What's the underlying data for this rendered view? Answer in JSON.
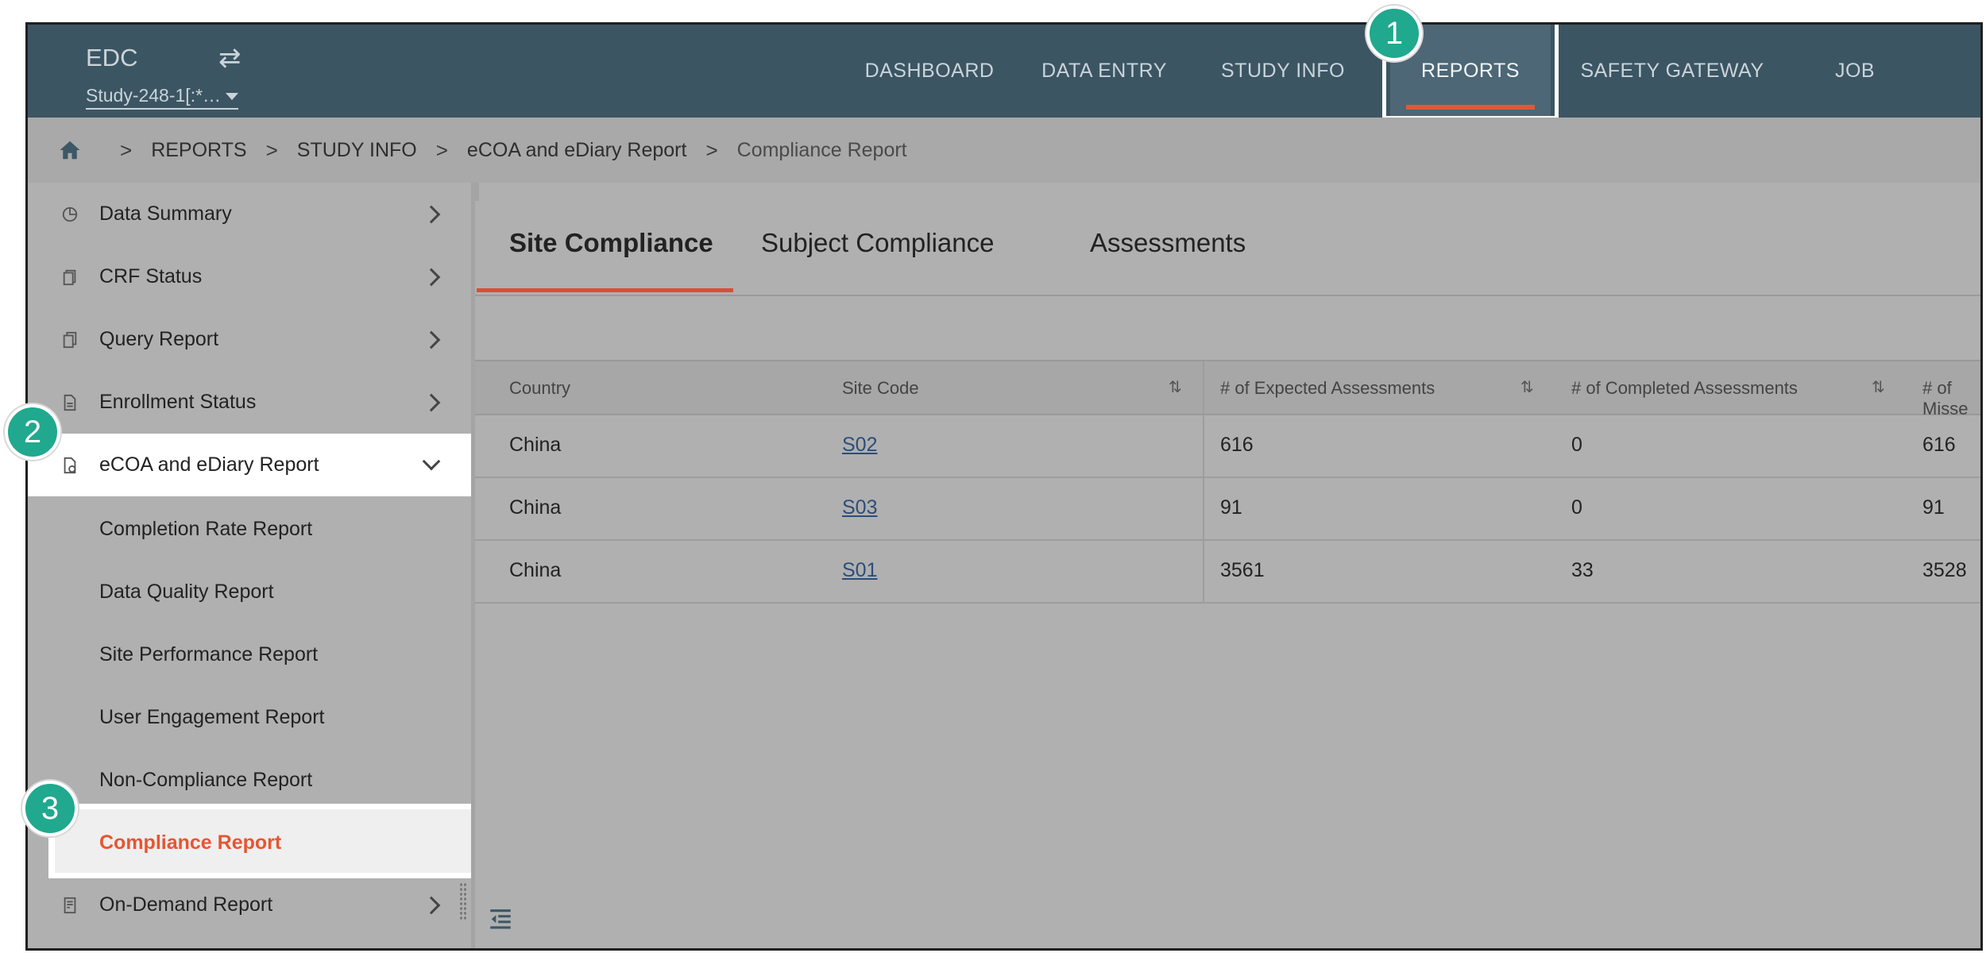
{
  "header": {
    "brand": "EDC",
    "study_selector": "Study-248-1[:*…",
    "nav": [
      "DASHBOARD",
      "DATA ENTRY",
      "STUDY INFO",
      "REPORTS",
      "SAFETY GATEWAY",
      "JOB"
    ],
    "active_nav": "REPORTS"
  },
  "breadcrumb": [
    "REPORTS",
    "STUDY INFO",
    "eCOA and eDiary Report",
    "Compliance Report"
  ],
  "sidebar": {
    "items": [
      {
        "label": "Data Summary",
        "icon": "pie-chart-icon"
      },
      {
        "label": "CRF Status",
        "icon": "crf-doc-icon"
      },
      {
        "label": "Query Report",
        "icon": "query-doc-icon"
      },
      {
        "label": "Enrollment Status",
        "icon": "enrollment-doc-icon"
      },
      {
        "label": "eCOA and eDiary Report",
        "icon": "ecoa-doc-icon",
        "expanded": true
      },
      {
        "label": "On-Demand Report",
        "icon": "on-demand-report-icon"
      }
    ],
    "subitems": [
      "Completion Rate Report",
      "Data Quality Report",
      "Site Performance Report",
      "User Engagement Report",
      "Non-Compliance Report",
      "Compliance Report"
    ],
    "active_subitem": "Compliance Report"
  },
  "tabs": [
    "Site Compliance",
    "Subject Compliance",
    "Assessments"
  ],
  "active_tab": "Site Compliance",
  "table": {
    "columns": [
      "Country",
      "Site Code",
      "# of Expected Assessments",
      "# of Completed Assessments",
      "# of Misse"
    ],
    "rows": [
      [
        "China",
        "S02",
        "616",
        "0",
        "616"
      ],
      [
        "China",
        "S03",
        "91",
        "0",
        "91"
      ],
      [
        "China",
        "S01",
        "3561",
        "33",
        "3528"
      ]
    ]
  },
  "markers": [
    "1",
    "2",
    "3"
  ],
  "colors": {
    "topbar": "#3c5563",
    "accent": "#e2573a",
    "marker": "#20a98e",
    "link": "#2c4d7a"
  }
}
